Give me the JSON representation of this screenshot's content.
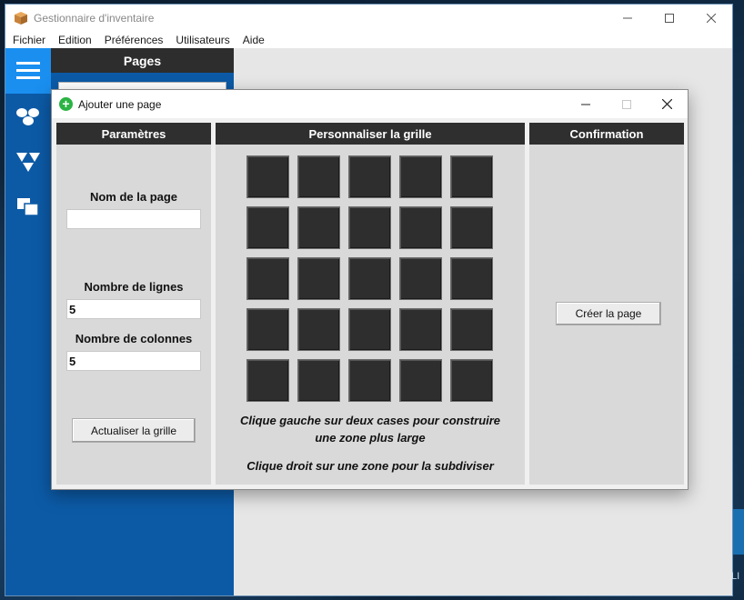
{
  "app": {
    "title": "Gestionnaire d'inventaire",
    "menu": [
      "Fichier",
      "Edition",
      "Préférences",
      "Utilisateurs",
      "Aide"
    ],
    "pages_header": "Pages",
    "sidebar_icons": [
      "hamburger-menu-icon",
      "cluster-icon",
      "triangles-icon",
      "windows-icon"
    ]
  },
  "dialog": {
    "title": "Ajouter une page",
    "params": {
      "header": "Paramètres",
      "name_label": "Nom de la page",
      "name_value": "",
      "rows_label": "Nombre de lignes",
      "rows_value": "5",
      "cols_label": "Nombre de colonnes",
      "cols_value": "5",
      "refresh_button": "Actualiser la grille"
    },
    "grid": {
      "header": "Personnaliser la grille",
      "rows": 5,
      "cols": 5,
      "hint_left": "Clique gauche sur deux cases pour construire une zone plus large",
      "hint_right": "Clique droit sur une zone pour la subdiviser"
    },
    "confirm": {
      "header": "Confirmation",
      "create_button": "Créer la page"
    }
  },
  "colors": {
    "sidebar_blue": "#0c5aa6",
    "active_blue": "#1a8ff0",
    "panel_header": "#2f2f2f",
    "grid_cell": "#2e2e2e",
    "add_icon_green": "#2bb344"
  }
}
